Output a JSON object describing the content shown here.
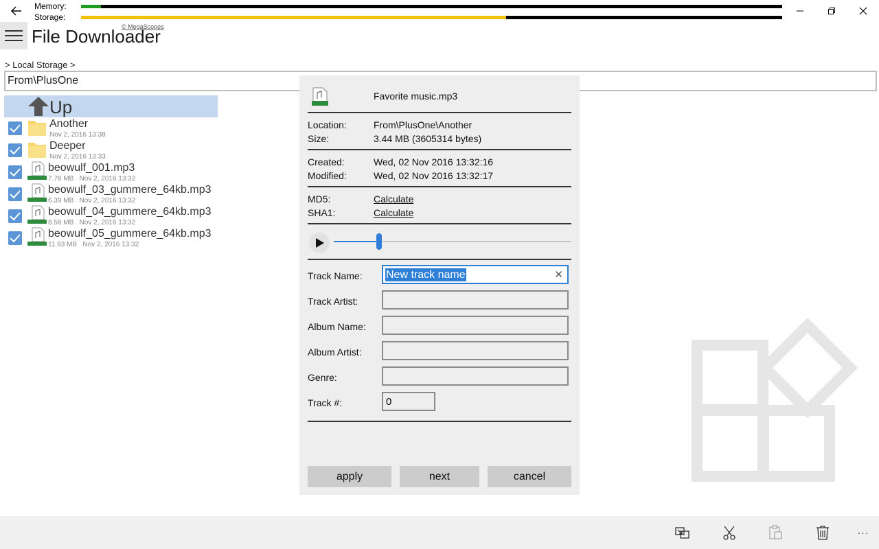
{
  "titlebar": {
    "memory_label": "Memory:",
    "storage_label": "Storage:",
    "memory_fraction": 0.028,
    "storage_fraction": 0.606,
    "colors": {
      "memory_bar": "#1e9a1e",
      "storage_bar": "#f2c200",
      "bar_bg": "#000000"
    }
  },
  "app": {
    "title": "File Downloader",
    "copyright": "© MegaScopes"
  },
  "breadcrumb": "> Local Storage >",
  "path": "From\\PlusOne",
  "list": {
    "up_label": "Up",
    "items": [
      {
        "type": "folder",
        "name": "Another",
        "size": "",
        "date": "Nov 2, 2016 13:38",
        "checked": true
      },
      {
        "type": "folder",
        "name": "Deeper",
        "size": "",
        "date": "Nov 2, 2016 13:33",
        "checked": true
      },
      {
        "type": "file",
        "name": "beowulf_001.mp3",
        "size": "7.78 MB",
        "date": "Nov 2, 2016 13:32",
        "checked": true
      },
      {
        "type": "file",
        "name": "beowulf_03_gummere_64kb.mp3",
        "size": "6.39 MB",
        "date": "Nov 2, 2016 13:32",
        "checked": true
      },
      {
        "type": "file",
        "name": "beowulf_04_gummere_64kb.mp3",
        "size": "8.58 MB",
        "date": "Nov 2, 2016 13:32",
        "checked": true
      },
      {
        "type": "file",
        "name": "beowulf_05_gummere_64kb.mp3",
        "size": "11.93 MB",
        "date": "Nov 2, 2016 13:32",
        "checked": true
      }
    ],
    "file_badge": "MP3"
  },
  "dialog": {
    "filename": "Favorite music.mp3",
    "location_label": "Location:",
    "location": "From\\PlusOne\\Another",
    "size_label": "Size:",
    "size": "3.44 MB (3605314 bytes)",
    "created_label": "Created:",
    "created": "Wed, 02 Nov 2016 13:32:16",
    "modified_label": "Modified:",
    "modified": "Wed, 02 Nov 2016 13:32:17",
    "md5_label": "MD5:",
    "md5_action": "Calculate",
    "sha1_label": "SHA1:",
    "sha1_action": "Calculate",
    "playback_fraction": 0.19,
    "fields": {
      "track_name_label": "Track Name:",
      "track_name_value": "New track name",
      "track_artist_label": "Track Artist:",
      "album_name_label": "Album Name:",
      "album_artist_label": "Album Artist:",
      "genre_label": "Genre:",
      "track_no_label": "Track #:",
      "track_no_value": "0"
    },
    "buttons": {
      "apply": "apply",
      "next": "next",
      "cancel": "cancel"
    },
    "accent": "#2d7fd8"
  },
  "appbar": {
    "icons": [
      "move-icon",
      "cut-icon",
      "paste-icon",
      "delete-icon",
      "more-icon"
    ],
    "more_label": "···"
  }
}
